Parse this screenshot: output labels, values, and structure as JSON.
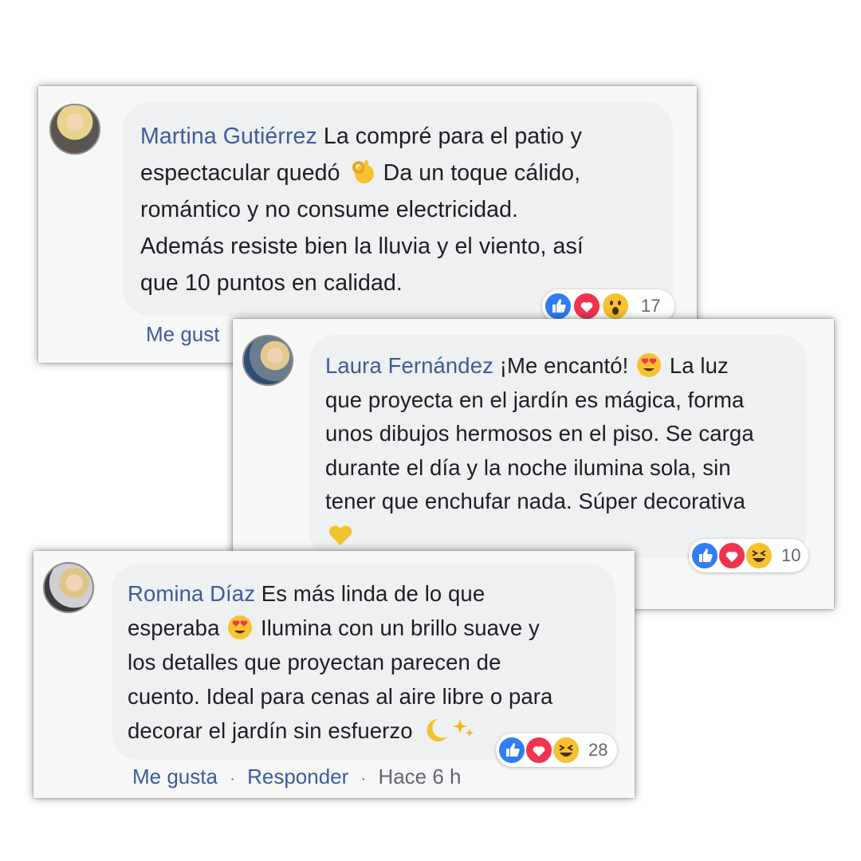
{
  "comments": [
    {
      "name": "Martina Gutiérrez",
      "lines": [
        "La compré para el patio y",
        "espectacular quedó",
        "Da un toque cálido,",
        "romántico y no consume electricidad.",
        "Además resiste bien la lluvia y el viento, así",
        "que 10 puntos en calidad."
      ],
      "emoji": "ok-hand-emoji",
      "reactions": [
        "like",
        "love",
        "wow"
      ],
      "reaction_count": "17",
      "action_like": "Me gust"
    },
    {
      "name": "Laura Fernández",
      "lines": [
        "¡Me encantó!",
        "La luz",
        "que proyecta en el jardín es mágica, forma",
        "unos dibujos hermosos en el piso. Se carga",
        "durante el día y la noche ilumina sola, sin",
        "tener que enchufar nada. Súper decorativa"
      ],
      "emoji": "heart-eyes-emoji",
      "emoji_end": "yellow-heart-emoji",
      "reactions": [
        "like",
        "love",
        "haha"
      ],
      "reaction_count": "10"
    },
    {
      "name": "Romina Díaz",
      "lines": [
        "Es más linda de lo que",
        "esperaba",
        "Ilumina con un brillo suave y",
        "los detalles que proyectan parecen de",
        "cuento. Ideal para cenas al aire libre o para",
        "decorar el jardín sin esfuerzo"
      ],
      "emoji": "heart-eyes-emoji",
      "emoji_end": "crescent-moon-sparkles-emoji",
      "reactions": [
        "like",
        "love",
        "haha"
      ],
      "reaction_count": "28",
      "action_like": "Me gusta",
      "action_reply": "Responder",
      "time": "Hace 6 h",
      "separator": "·"
    }
  ],
  "colors": {
    "name": "#3e5a9b",
    "text": "#1c1e21",
    "bubble": "#eff0f2",
    "like": "#2f7cf6",
    "love": "#f0344f",
    "emoji_yellow": "#f7c230"
  }
}
